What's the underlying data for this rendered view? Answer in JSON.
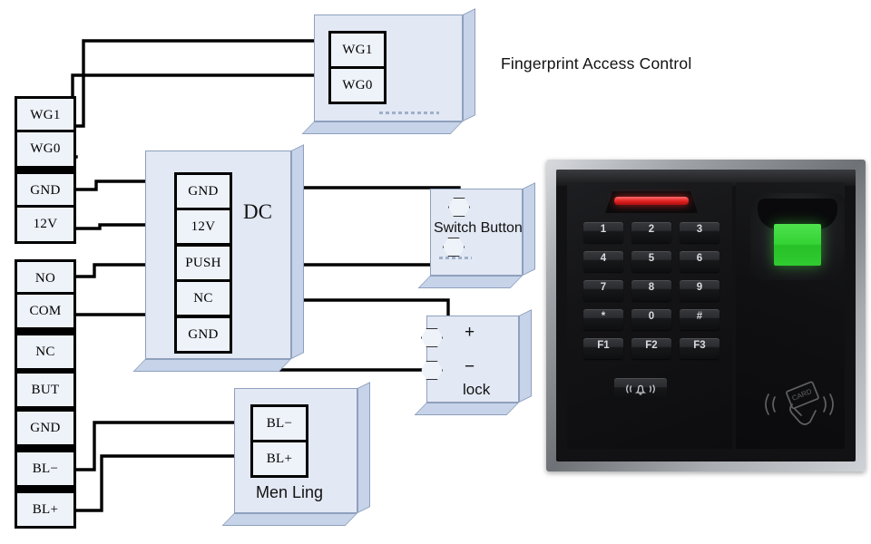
{
  "title": "Fingerprint Access Control",
  "terminal_blocks": [
    {
      "name": "wiegand-power-block",
      "terminals": [
        "WG1",
        "WG0",
        "GND",
        "12V"
      ]
    },
    {
      "name": "relay-bell-block",
      "terminals": [
        "NO",
        "COM",
        "NC",
        "BUT",
        "GND",
        "BL−",
        "BL+"
      ]
    }
  ],
  "boxes": {
    "wiegand_reader": {
      "label": "",
      "terminals": [
        "WG1",
        "WG0"
      ]
    },
    "power_supply": {
      "label": "DC",
      "terminals": [
        "GND",
        "12V",
        "PUSH",
        "NC",
        "GND"
      ]
    },
    "switch_button": {
      "label": "Switch Button",
      "terminals": [
        "",
        ""
      ]
    },
    "lock": {
      "label": "lock",
      "terminals": [
        "+",
        "−"
      ]
    },
    "door_bell": {
      "label": "Men Ling",
      "terminals": [
        "BL−",
        "BL+"
      ]
    }
  },
  "device": {
    "name": "fingerprint-access-control-terminal",
    "keypad": [
      "1",
      "2",
      "3",
      "4",
      "5",
      "6",
      "7",
      "8",
      "9",
      "*",
      "0",
      "#",
      "F1",
      "F2",
      "F3"
    ],
    "bell_button_label": "doorbell",
    "card_label": "CARD",
    "led_color": "#e02020",
    "sensor_color": "#34d334",
    "bezel_color": "#9fa3a8",
    "body_color": "#121214"
  },
  "colors": {
    "wire": "#000000",
    "box_face": "#e2e8f4",
    "box_side": "#c6d3e8",
    "terminal_fill": "#eef2f9",
    "terminal_border": "#000000"
  }
}
